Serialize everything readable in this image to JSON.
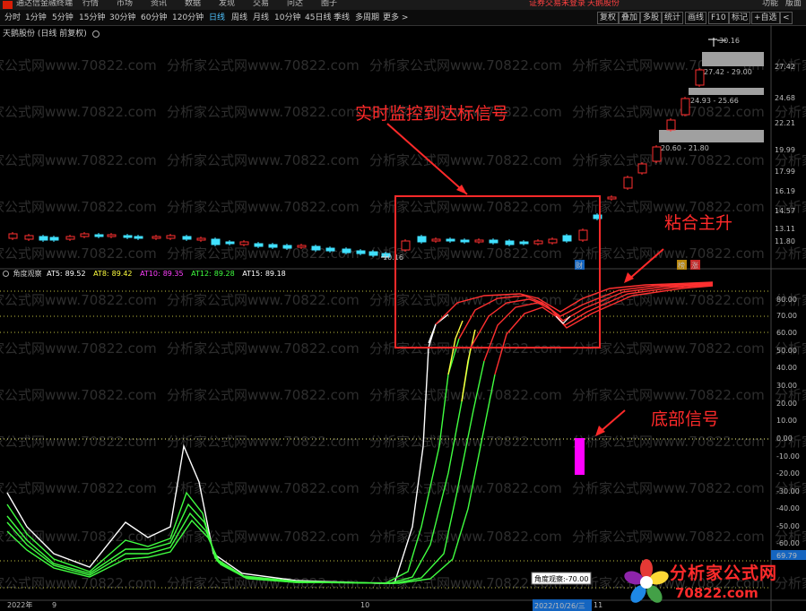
{
  "menubar": {
    "app_name": "通达信金融终端",
    "items": [
      "行情",
      "市场",
      "资讯",
      "数据",
      "发现",
      "交易",
      "问达",
      "圈子"
    ],
    "broker_notice": "证券交易未登录",
    "stock_notice": "天鹅股份",
    "right_items": [
      "功能",
      "版面"
    ]
  },
  "toolbar": {
    "periods": [
      "分时",
      "1分钟",
      "5分钟",
      "15分钟",
      "30分钟",
      "60分钟",
      "120分钟",
      "日线",
      "周线",
      "月线",
      "10分钟",
      "45日线",
      "季线",
      "多周期",
      "更多 >"
    ],
    "active_period": "日线",
    "buttons": [
      "复权",
      "叠加",
      "多股",
      "统计",
      "画线",
      "F10",
      "标记",
      "+自选",
      "<"
    ]
  },
  "title": "天鹅股份 (日线 前复权)",
  "price_axis": [
    "27.42",
    "24.68",
    "22.21",
    "19.99",
    "17.99",
    "16.19",
    "14.57",
    "13.11",
    "11.80"
  ],
  "price_markers": {
    "high_label": "30.16",
    "low_label": "10.16"
  },
  "volume_profile": [
    {
      "label": "27.42 - 29.00"
    },
    {
      "label": "24.93 - 25.66"
    },
    {
      "label": "20.60 - 21.80"
    }
  ],
  "event_badges": [
    "财",
    "榜",
    "涨"
  ],
  "indicator": {
    "name": "角度观察",
    "values": [
      {
        "label": "AT5:",
        "value": "89.52",
        "color": "#ffffff"
      },
      {
        "label": "AT8:",
        "value": "89.42",
        "color": "#ffff40"
      },
      {
        "label": "AT10:",
        "value": "89.35",
        "color": "#ff40ff"
      },
      {
        "label": "AT12:",
        "value": "89.28",
        "color": "#40ff40"
      },
      {
        "label": "AT15:",
        "value": "89.18",
        "color": "#ffffff"
      }
    ],
    "axis": [
      "80.00",
      "70.00",
      "60.00",
      "50.00",
      "40.00",
      "30.00",
      "20.00",
      "10.00",
      "0.00",
      "-10.00",
      "-20.00",
      "-30.00",
      "-40.00",
      "-50.00",
      "-60.00"
    ],
    "current_value_box": "69.79",
    "tooltip": "角度观察:-70.00"
  },
  "annotations": {
    "realtime": "实时监控到达标信号",
    "stick": "粘合主升",
    "bottom": "底部信号"
  },
  "time_axis": {
    "start": "2022年",
    "month_9": "9",
    "month_10": "10",
    "cursor_date": "2022/10/26/三",
    "month_11": "11"
  },
  "watermark": "分析家公式网www.70822.com",
  "logo": {
    "name": "分析家公式网",
    "url": "70822.com"
  },
  "colors": {
    "up": "#ff3030",
    "down": "#40e0ff",
    "bottom_signal": "#ff00ff",
    "accent": "#ff2a2a"
  }
}
